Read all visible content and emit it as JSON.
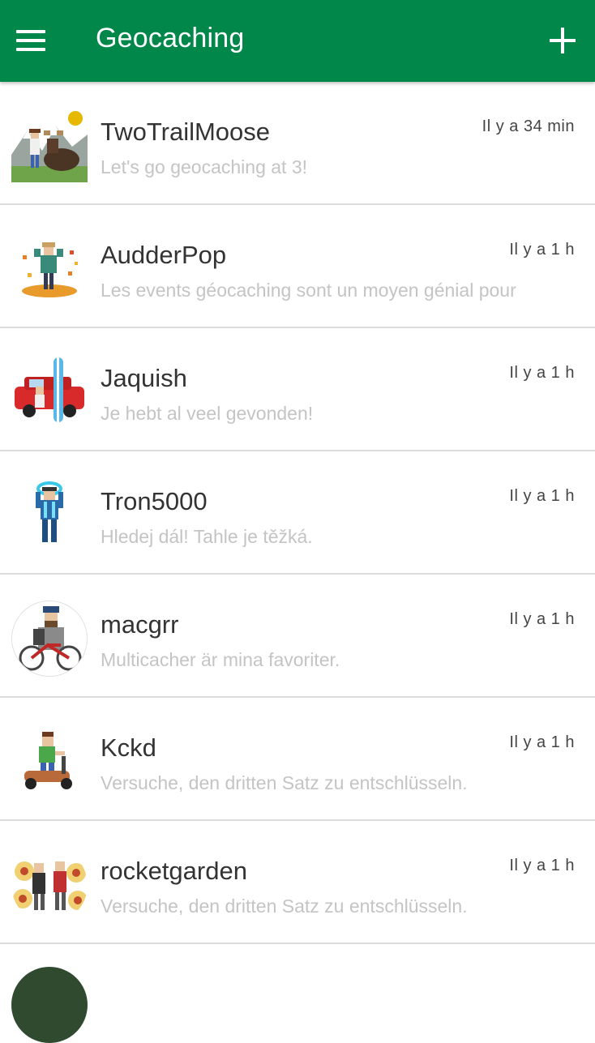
{
  "app_bar": {
    "title": "Geocaching",
    "menu_icon": "hamburger-menu-icon",
    "add_icon": "plus-icon",
    "color": "#02874a"
  },
  "conversations": [
    {
      "name": "TwoTrailMoose",
      "message": "Let's go geocaching at 3!",
      "time": "Il y a 34 min",
      "unread": true,
      "avatar": "moose-avatar"
    },
    {
      "name": "AudderPop",
      "message": "Les events géocaching sont un moyen génial pour",
      "time": "Il y a 1 h",
      "unread": false,
      "avatar": "autumn-avatar"
    },
    {
      "name": "Jaquish",
      "message": "Je hebt al veel gevonden!",
      "time": "Il y a 1 h",
      "unread": false,
      "avatar": "car-surfboard-avatar"
    },
    {
      "name": "Tron5000",
      "message": "Hledej dál! Tahle je těžká.",
      "time": "Il y a 1 h",
      "unread": false,
      "avatar": "tron-avatar"
    },
    {
      "name": "macgrr",
      "message": "Multicacher är mina favoriter.",
      "time": "Il y a 1 h",
      "unread": false,
      "avatar": "bike-avatar"
    },
    {
      "name": "Kckd",
      "message": "Versuche, den dritten Satz zu entschlüsseln.",
      "time": "Il y a 1 h",
      "unread": false,
      "avatar": "scooter-avatar"
    },
    {
      "name": "rocketgarden",
      "message": "Versuche, den dritten Satz zu entschlüsseln.",
      "time": "Il y a 1 h",
      "unread": false,
      "avatar": "flowers-avatar"
    }
  ],
  "colors": {
    "unread_dot": "#e6b800",
    "name_text": "#333333",
    "message_text": "#c4c4c4",
    "divider": "#dcdcdc"
  }
}
